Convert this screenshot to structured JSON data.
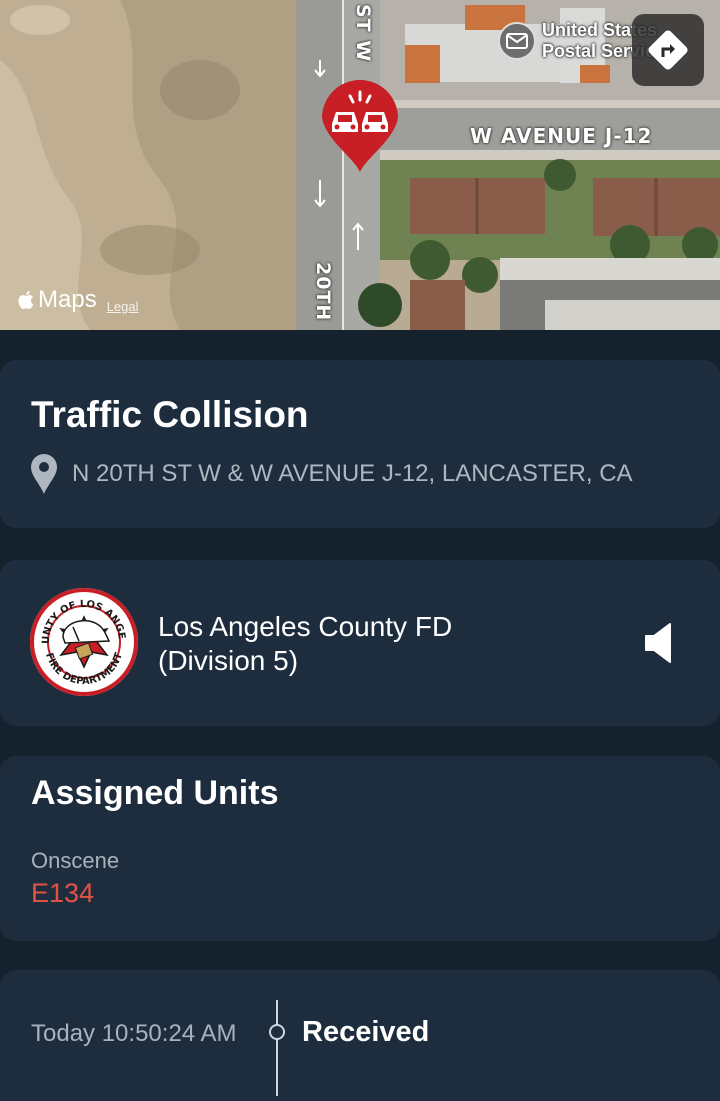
{
  "map": {
    "street_avenue": "W AVENUE J-12",
    "street_20th": "20TH",
    "street_st_w": "ST W",
    "poi_line1": "United States",
    "poi_line2": "Postal Service",
    "brand": "Maps",
    "legal": "Legal"
  },
  "incident": {
    "title": "Traffic Collision",
    "address": "N 20TH ST W & W AVENUE J-12, LANCASTER, CA"
  },
  "agency": {
    "name_line1": "Los Angeles County FD",
    "name_line2": "(Division 5)",
    "logo_text_top": "COUNTY OF LOS ANGELES",
    "logo_text_bottom": "FIRE DEPARTMENT"
  },
  "units": {
    "title": "Assigned Units",
    "status": "Onscene",
    "unit": "E134",
    "unit_color": "#e25346"
  },
  "timeline": {
    "time": "Today 10:50:24 AM",
    "event": "Received"
  },
  "icons": {
    "pin": "incident-pin-icon",
    "location": "location-pin-icon",
    "speaker": "speaker-icon",
    "directions": "directions-icon",
    "mail": "mail-icon",
    "apple": "apple-icon"
  },
  "colors": {
    "background": "#15222e",
    "card": "#1e2d3e",
    "accent_red": "#c81e25"
  }
}
